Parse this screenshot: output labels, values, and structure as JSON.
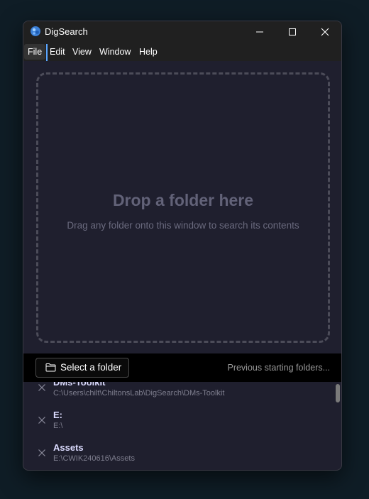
{
  "window": {
    "title": "DigSearch",
    "minimize_icon": "minimize-icon",
    "maximize_icon": "maximize-icon",
    "close_icon": "close-icon"
  },
  "menu": {
    "items": [
      {
        "label": "File",
        "active": true
      },
      {
        "label": "Edit"
      },
      {
        "label": "View"
      },
      {
        "label": "Window"
      },
      {
        "label": "Help"
      }
    ]
  },
  "dropzone": {
    "title": "Drop a folder here",
    "subtitle": "Drag any folder onto this window to search its contents"
  },
  "actions": {
    "select_button_label": "Select a folder",
    "select_button_icon": "folder-icon",
    "previous_label": "Previous starting folders..."
  },
  "recent_folders": [
    {
      "name": "DMs-Toolkit",
      "path": "C:\\Users\\chilt\\ChiltonsLab\\DigSearch\\DMs-Toolkit"
    },
    {
      "name": "E:",
      "path": "E:\\"
    },
    {
      "name": "Assets",
      "path": "E:\\CWIK240616\\Assets"
    }
  ],
  "colors": {
    "accent": "#5aa6ff",
    "window_bg": "#1f1f2e",
    "titlebar_bg": "#202020"
  }
}
